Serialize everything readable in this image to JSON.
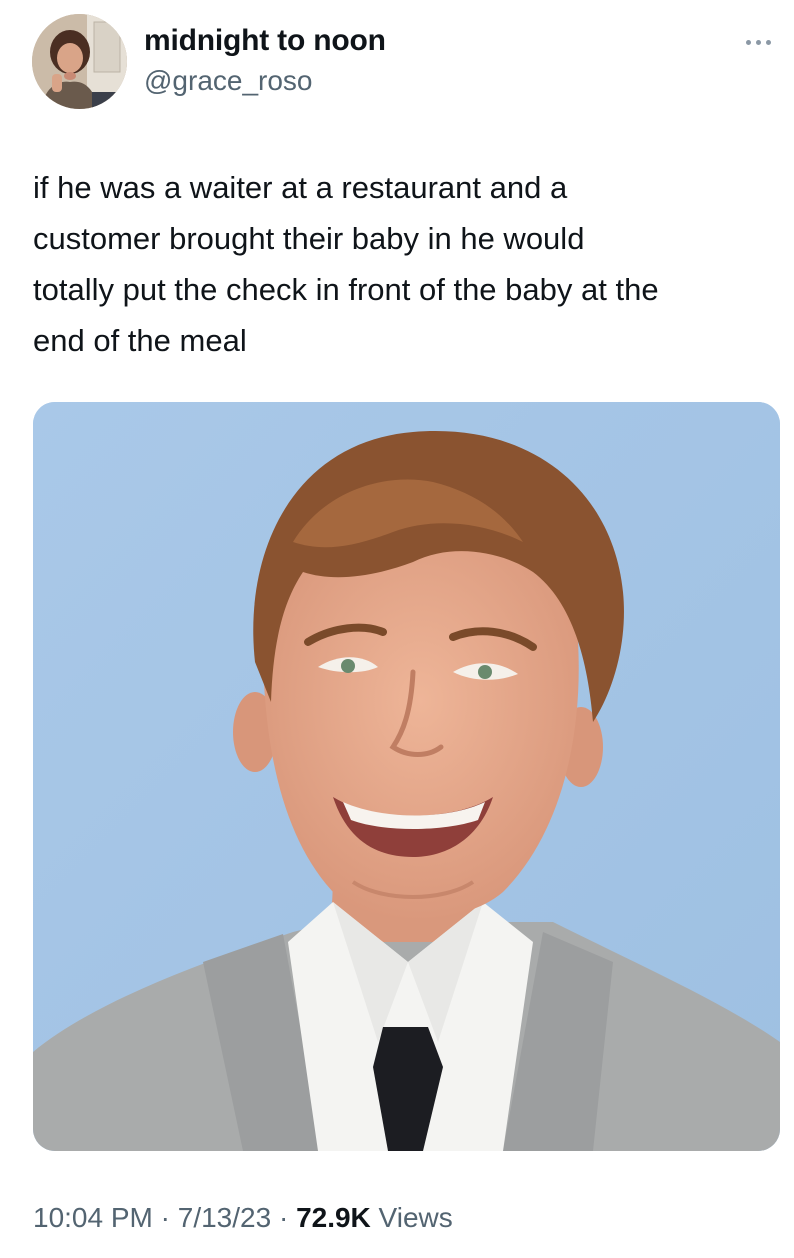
{
  "author": {
    "display_name": "midnight to noon",
    "handle": "@grace_roso",
    "avatar_icon": "profile-photo"
  },
  "more_icon": "ellipsis-icon",
  "tweet": {
    "text": "if he was a waiter at a restaurant and a\ncustomer brought their baby in he would\ntotally put the check in front of the baby at the\nend of the meal"
  },
  "media": {
    "kind": "photo",
    "colors": {
      "background": "#a8c7e6",
      "suit": "#a9abab",
      "shirt": "#f4f4f2",
      "tie": "#1c1d22",
      "hair": "#8a5330",
      "skin": "#e5a98a"
    }
  },
  "meta": {
    "time": "10:04 PM",
    "sep1": " · ",
    "date": "7/13/23",
    "sep2": " · ",
    "views_count": "72.9K",
    "views_label": " Views"
  }
}
